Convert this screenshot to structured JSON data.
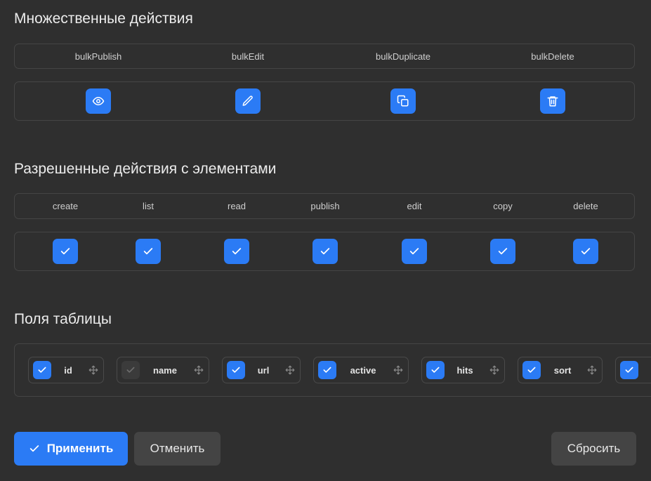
{
  "bulk_section": {
    "title": "Множественные действия",
    "headers": [
      "bulkPublish",
      "bulkEdit",
      "bulkDuplicate",
      "bulkDelete"
    ],
    "actions": [
      {
        "icon": "eye-icon"
      },
      {
        "icon": "pencil-icon"
      },
      {
        "icon": "copy-icon"
      },
      {
        "icon": "trash-icon"
      }
    ]
  },
  "permissions_section": {
    "title": "Разрешенные действия с элементами",
    "headers": [
      "create",
      "list",
      "read",
      "publish",
      "edit",
      "copy",
      "delete"
    ],
    "checked": [
      true,
      true,
      true,
      true,
      true,
      true,
      true
    ]
  },
  "fields_section": {
    "title": "Поля таблицы",
    "fields": [
      {
        "label": "id",
        "checked": true
      },
      {
        "label": "name",
        "checked": false
      },
      {
        "label": "url",
        "checked": true
      },
      {
        "label": "active",
        "checked": true
      },
      {
        "label": "hits",
        "checked": true
      },
      {
        "label": "sort",
        "checked": true
      },
      {
        "label": "",
        "checked": true
      }
    ]
  },
  "buttons": {
    "apply": "Применить",
    "cancel": "Отменить",
    "reset": "Сбросить"
  },
  "colors": {
    "accent": "#2b7bf5",
    "background": "#2f2f2f",
    "secondary_button": "#444444"
  }
}
